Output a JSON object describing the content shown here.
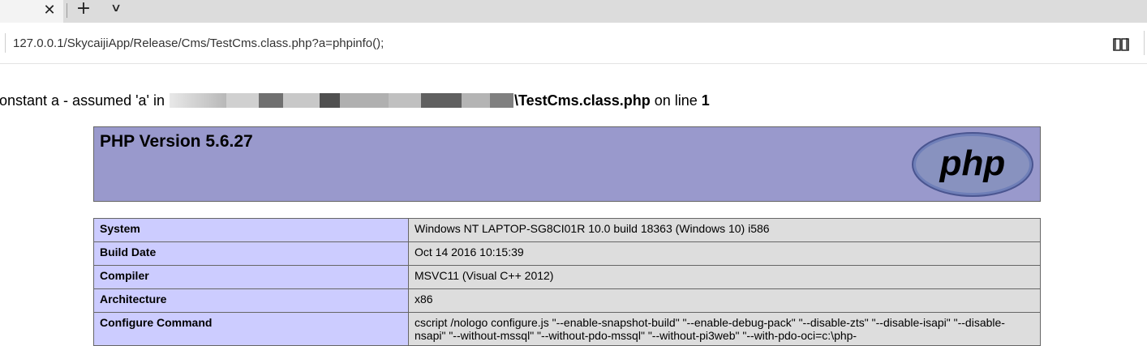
{
  "browser": {
    "tab_close_icon": "close-icon",
    "new_tab_icon": "plus-icon",
    "tab_list_icon": "chevron-down-icon",
    "url": "127.0.0.1/SkycaijiApp/Release/Cms/TestCms.class.php?a=phpinfo();",
    "reading_view_icon": "book-icon"
  },
  "warning": {
    "prefix": "onstant a - assumed 'a' in ",
    "path_suffix": "\\TestCms.class.php",
    "mid": " on line ",
    "line": "1"
  },
  "phpinfo": {
    "version_title": "PHP Version 5.6.27",
    "logo_text": "php",
    "colors": {
      "header_bg": "#9999cc",
      "key_bg": "#ccccff",
      "value_bg": "#dddddd",
      "border": "#666666"
    },
    "rows": [
      {
        "key": "System",
        "value": "Windows NT LAPTOP-SG8CI01R 10.0 build 18363 (Windows 10) i586"
      },
      {
        "key": "Build Date",
        "value": "Oct 14 2016 10:15:39"
      },
      {
        "key": "Compiler",
        "value": "MSVC11 (Visual C++ 2012)"
      },
      {
        "key": "Architecture",
        "value": "x86"
      },
      {
        "key": "Configure Command",
        "value": "cscript /nologo configure.js \"--enable-snapshot-build\" \"--enable-debug-pack\" \"--disable-zts\" \"--disable-isapi\" \"--disable-nsapi\" \"--without-mssql\" \"--without-pdo-mssql\" \"--without-pi3web\" \"--with-pdo-oci=c:\\php-"
      }
    ]
  }
}
